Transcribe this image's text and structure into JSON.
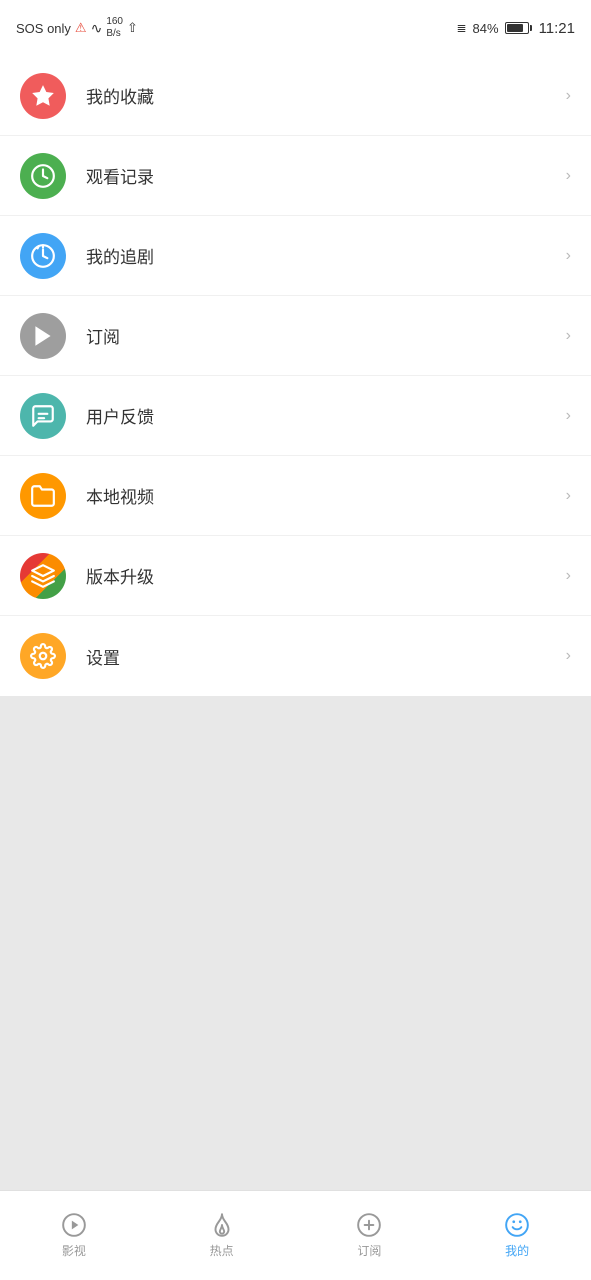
{
  "statusBar": {
    "sos": "SOS only",
    "speed": "160\nB/s",
    "battery_pct": "84%",
    "time": "11:21"
  },
  "menuItems": [
    {
      "id": "favorites",
      "label": "我的收藏",
      "iconColor": "icon-red",
      "iconType": "star"
    },
    {
      "id": "history",
      "label": "观看记录",
      "iconColor": "icon-green",
      "iconType": "clock"
    },
    {
      "id": "series",
      "label": "我的追剧",
      "iconColor": "icon-blue",
      "iconType": "alarm"
    },
    {
      "id": "subscribe",
      "label": "订阅",
      "iconColor": "icon-gray",
      "iconType": "play"
    },
    {
      "id": "feedback",
      "label": "用户反馈",
      "iconColor": "icon-teal",
      "iconType": "chat"
    },
    {
      "id": "local",
      "label": "本地视频",
      "iconColor": "icon-orange",
      "iconType": "folder"
    },
    {
      "id": "update",
      "label": "版本升级",
      "iconColor": "icon-multi",
      "iconType": "layers"
    },
    {
      "id": "settings",
      "label": "设置",
      "iconColor": "icon-amber",
      "iconType": "gear"
    }
  ],
  "bottomNav": [
    {
      "id": "movies",
      "label": "影视",
      "active": false,
      "iconType": "play-circle"
    },
    {
      "id": "hot",
      "label": "热点",
      "active": false,
      "iconType": "fire"
    },
    {
      "id": "subscribe",
      "label": "订阅",
      "active": false,
      "iconType": "plus-circle"
    },
    {
      "id": "mine",
      "label": "我的",
      "active": true,
      "iconType": "smiley"
    }
  ]
}
